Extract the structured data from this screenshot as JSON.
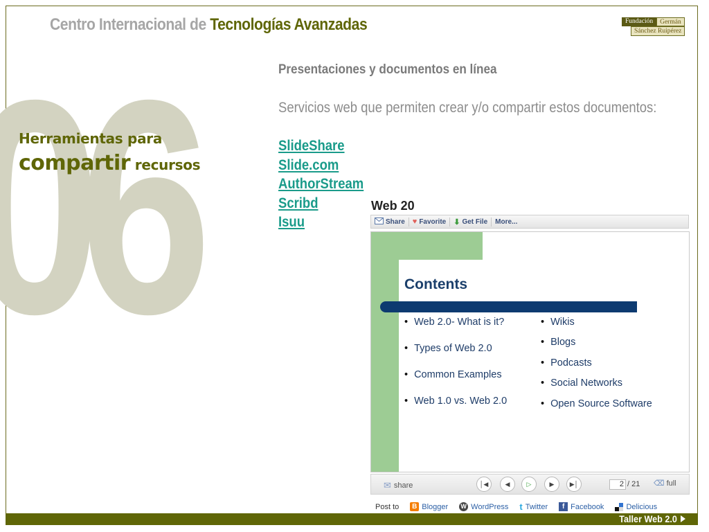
{
  "header": {
    "title_light": "Centro Internacional de ",
    "title_dark": "Tecnologías Avanzadas",
    "logo": {
      "line1_a": "Fundación",
      "line1_b": "Germán",
      "line2": "Sánchez Ruipérez"
    }
  },
  "section": {
    "number": "06",
    "title_line1": "Herramientas para",
    "title_word_big": "compartir",
    "title_word_small": " recursos"
  },
  "content": {
    "title": "Presentaciones y documentos en línea",
    "subtitle": "Servicios web que permiten crear y/o compartir estos documentos:",
    "links": [
      "SlideShare",
      "Slide.com",
      "AuthorStream",
      "Scribd",
      "Isuu"
    ]
  },
  "embed": {
    "title": "Web 20",
    "toolbar": {
      "share": "Share",
      "favorite": "Favorite",
      "get_file": "Get File",
      "more": "More..."
    },
    "slide": {
      "heading": "Contents",
      "left_items": [
        "Web 2.0- What is it?",
        "Types of Web 2.0",
        "Common Examples",
        "Web 1.0 vs. Web 2.0"
      ],
      "right_items": [
        "Wikis",
        "Blogs",
        "Podcasts",
        "Social Networks",
        "Open Source Software"
      ]
    },
    "controls": {
      "share": "share",
      "current_page": "2",
      "total_pages": "/ 21",
      "full": "full"
    },
    "post_to": {
      "label": "Post to",
      "services": [
        "Blogger",
        "WordPress",
        "Twitter",
        "Facebook",
        "Delicious"
      ]
    }
  },
  "footer": {
    "label": "Taller Web 2.0"
  },
  "colors": {
    "olive": "#5f6607",
    "link": "#1a9b8a",
    "navy": "#0d3a70",
    "slide_green": "#9dcc94",
    "watermark": "#d3d3c1"
  }
}
